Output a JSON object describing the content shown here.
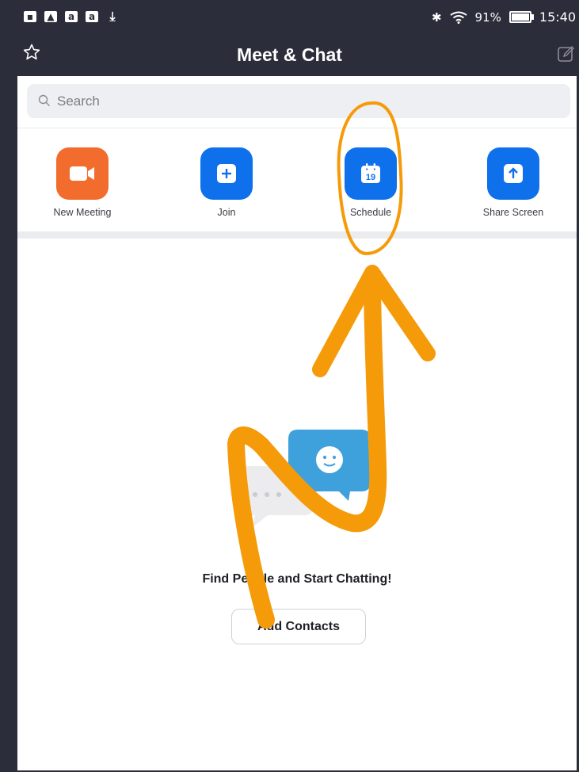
{
  "status_bar": {
    "left_icons": [
      "notification-icon",
      "image-icon",
      "amazon-icon",
      "amazon-icon",
      "download-icon"
    ],
    "battery": "91%",
    "time": "15:40"
  },
  "header": {
    "title": "Meet & Chat"
  },
  "search": {
    "placeholder": "Search"
  },
  "actions": [
    {
      "label": "New Meeting",
      "icon": "video-camera-icon",
      "color": "#f26d2d"
    },
    {
      "label": "Join",
      "icon": "plus-icon",
      "color": "#0e71eb"
    },
    {
      "label": "Schedule",
      "icon": "calendar-icon",
      "color": "#0e71eb",
      "calendar_day": "19"
    },
    {
      "label": "Share Screen",
      "icon": "share-up-arrow-icon",
      "color": "#0e71eb"
    }
  ],
  "empty_state": {
    "title": "Find People and Start Chatting!",
    "button_label": "Add Contacts"
  },
  "colors": {
    "header_bg": "#2c2d3a",
    "accent_blue": "#0e71eb",
    "accent_orange": "#f26d2d",
    "annotation_orange": "#f59b0a"
  }
}
